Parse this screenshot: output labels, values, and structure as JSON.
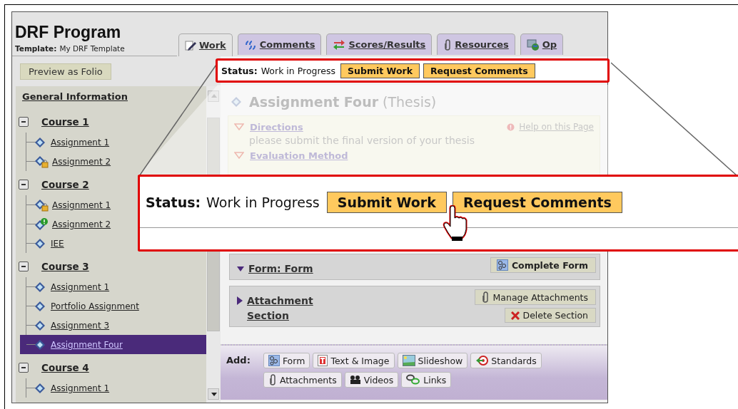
{
  "program": {
    "title": "DRF Program",
    "template_label": "Template:",
    "template_name": "My DRF Template"
  },
  "tabs": [
    {
      "label": "Work",
      "kind": "pencil",
      "selected": true
    },
    {
      "label": "Comments",
      "kind": "quotes",
      "selected": false
    },
    {
      "label": "Scores/Results",
      "kind": "arrows",
      "selected": false
    },
    {
      "label": "Resources",
      "kind": "clip",
      "selected": false
    },
    {
      "label": "Op",
      "kind": "globe",
      "selected": false
    }
  ],
  "preview_button": "Preview as Folio",
  "sidebar": {
    "heading": "General Information",
    "items": [
      {
        "label": "Course 1",
        "expanded": true,
        "children": [
          {
            "label": "Assignment 1",
            "kind": "plain",
            "selected": false
          },
          {
            "label": "Assignment 2",
            "kind": "locked",
            "selected": false
          }
        ]
      },
      {
        "label": "Course 2",
        "expanded": true,
        "children": [
          {
            "label": "Assignment 1",
            "kind": "locked",
            "selected": false
          },
          {
            "label": "Assignment 2",
            "kind": "alert",
            "selected": false
          },
          {
            "label": "IEE",
            "kind": "plain",
            "selected": false
          }
        ]
      },
      {
        "label": "Course 3",
        "expanded": true,
        "children": [
          {
            "label": "Assignment 1",
            "kind": "plain",
            "selected": false
          },
          {
            "label": "Portfolio Assignment",
            "kind": "plain",
            "selected": false
          },
          {
            "label": "Assignment 3",
            "kind": "plain",
            "selected": false
          },
          {
            "label": "Assignment Four",
            "kind": "plain",
            "selected": true
          }
        ]
      },
      {
        "label": "Course 4",
        "expanded": true,
        "children": [
          {
            "label": "Assignment 1",
            "kind": "plain",
            "selected": false
          }
        ]
      }
    ]
  },
  "status": {
    "label": "Status:",
    "value": "Work in Progress",
    "buttons": [
      "Submit Work",
      "Request Comments"
    ]
  },
  "assignment": {
    "title": "Assignment Four",
    "subtitle": "(Thesis)"
  },
  "directions": {
    "heading": "Directions",
    "help": "Help on this Page",
    "text": "please submit the final version of your thesis",
    "evaluation": "Evaluation Method"
  },
  "sections": [
    {
      "title": "Form: Form",
      "expanded": true,
      "buttons": [
        {
          "label": "Complete Form",
          "kind": "form"
        }
      ]
    },
    {
      "title": "Attachment Section",
      "expanded": false,
      "buttons": [
        {
          "label": "Manage Attachments",
          "kind": "clip"
        },
        {
          "label": "Delete Section",
          "kind": "delete"
        }
      ]
    }
  ],
  "add_bar": {
    "label": "Add:",
    "buttons": [
      {
        "label": "Form",
        "kind": "form"
      },
      {
        "label": "Text & Image",
        "kind": "text"
      },
      {
        "label": "Slideshow",
        "kind": "slides"
      },
      {
        "label": "Standards",
        "kind": "standards"
      },
      {
        "label": "Attachments",
        "kind": "clip"
      },
      {
        "label": "Videos",
        "kind": "camera"
      },
      {
        "label": "Links",
        "kind": "links"
      }
    ]
  },
  "callout": {
    "status_label": "Status:",
    "status_value": "Work in Progress",
    "buttons": [
      "Submit Work",
      "Request Comments"
    ]
  }
}
